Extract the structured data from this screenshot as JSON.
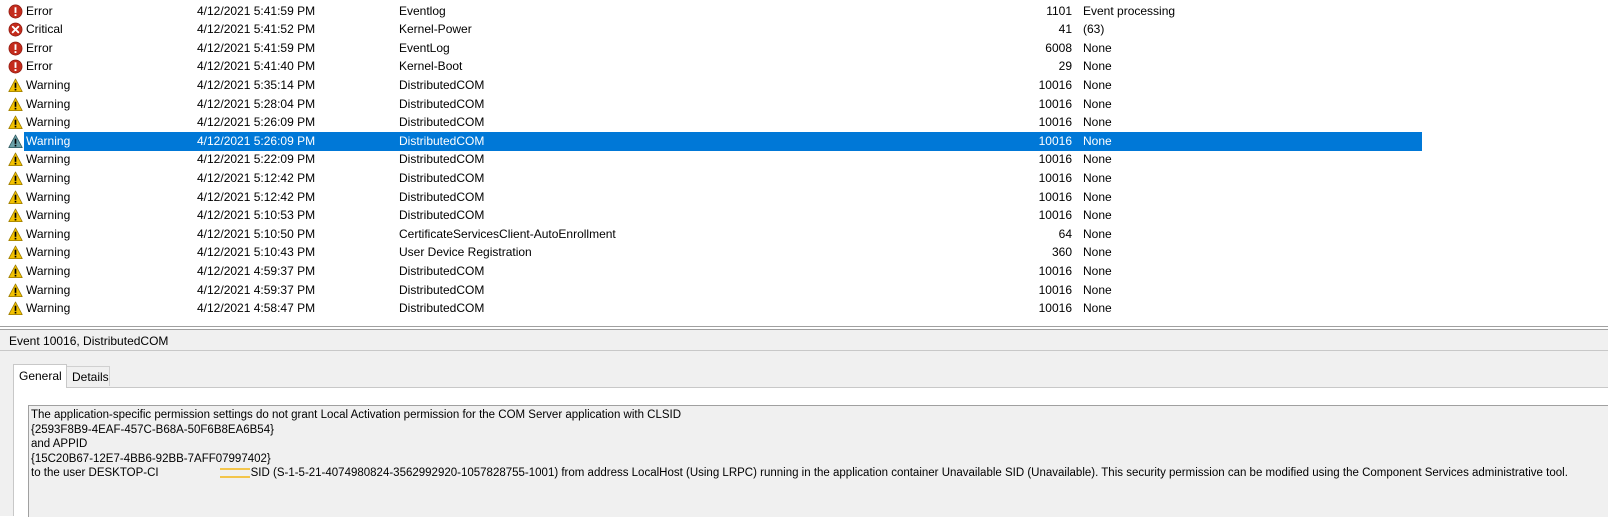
{
  "events": [
    {
      "level": "Error",
      "icon": "error",
      "date": "4/12/2021 5:41:59 PM",
      "source": "Eventlog",
      "id": "1101",
      "task": "Event processing"
    },
    {
      "level": "Critical",
      "icon": "critical",
      "date": "4/12/2021 5:41:52 PM",
      "source": "Kernel-Power",
      "id": "41",
      "task": "(63)"
    },
    {
      "level": "Error",
      "icon": "error",
      "date": "4/12/2021 5:41:59 PM",
      "source": "EventLog",
      "id": "6008",
      "task": "None"
    },
    {
      "level": "Error",
      "icon": "error",
      "date": "4/12/2021 5:41:40 PM",
      "source": "Kernel-Boot",
      "id": "29",
      "task": "None"
    },
    {
      "level": "Warning",
      "icon": "warning",
      "date": "4/12/2021 5:35:14 PM",
      "source": "DistributedCOM",
      "id": "10016",
      "task": "None"
    },
    {
      "level": "Warning",
      "icon": "warning",
      "date": "4/12/2021 5:28:04 PM",
      "source": "DistributedCOM",
      "id": "10016",
      "task": "None"
    },
    {
      "level": "Warning",
      "icon": "warning",
      "date": "4/12/2021 5:26:09 PM",
      "source": "DistributedCOM",
      "id": "10016",
      "task": "None"
    },
    {
      "level": "Warning",
      "icon": "warning",
      "date": "4/12/2021 5:26:09 PM",
      "source": "DistributedCOM",
      "id": "10016",
      "task": "None",
      "selected": true
    },
    {
      "level": "Warning",
      "icon": "warning",
      "date": "4/12/2021 5:22:09 PM",
      "source": "DistributedCOM",
      "id": "10016",
      "task": "None"
    },
    {
      "level": "Warning",
      "icon": "warning",
      "date": "4/12/2021 5:12:42 PM",
      "source": "DistributedCOM",
      "id": "10016",
      "task": "None"
    },
    {
      "level": "Warning",
      "icon": "warning",
      "date": "4/12/2021 5:12:42 PM",
      "source": "DistributedCOM",
      "id": "10016",
      "task": "None"
    },
    {
      "level": "Warning",
      "icon": "warning",
      "date": "4/12/2021 5:10:53 PM",
      "source": "DistributedCOM",
      "id": "10016",
      "task": "None"
    },
    {
      "level": "Warning",
      "icon": "warning",
      "date": "4/12/2021 5:10:50 PM",
      "source": "CertificateServicesClient-AutoEnrollment",
      "id": "64",
      "task": "None"
    },
    {
      "level": "Warning",
      "icon": "warning",
      "date": "4/12/2021 5:10:43 PM",
      "source": "User Device Registration",
      "id": "360",
      "task": "None"
    },
    {
      "level": "Warning",
      "icon": "warning",
      "date": "4/12/2021 4:59:37 PM",
      "source": "DistributedCOM",
      "id": "10016",
      "task": "None"
    },
    {
      "level": "Warning",
      "icon": "warning",
      "date": "4/12/2021 4:59:37 PM",
      "source": "DistributedCOM",
      "id": "10016",
      "task": "None"
    },
    {
      "level": "Warning",
      "icon": "warning",
      "date": "4/12/2021 4:58:47 PM",
      "source": "DistributedCOM",
      "id": "10016",
      "task": "None"
    }
  ],
  "detail": {
    "header": "Event 10016, DistributedCOM",
    "tabs": {
      "general": "General",
      "details": "Details"
    },
    "message": {
      "line1": "The application-specific permission settings do not grant Local Activation permission for the COM Server application with CLSID",
      "line2": "{2593F8B9-4EAF-457C-B68A-50F6B8EA6B54}",
      "line3": " and APPID",
      "line4": "{15C20B67-12E7-4BB6-92BB-7AFF07997402}",
      "line5a": " to the user DESKTOP-CI",
      "line5b": "SID (S-1-5-21-4074980824-3562992920-1057828755-1001) from address LocalHost (Using LRPC) running in the application container Unavailable SID (Unavailable). This security permission can be modified using the Component Services administrative tool."
    }
  },
  "colors": {
    "selection": "#0078d7",
    "error": "#c42b1c",
    "warning": "#f2c100"
  }
}
